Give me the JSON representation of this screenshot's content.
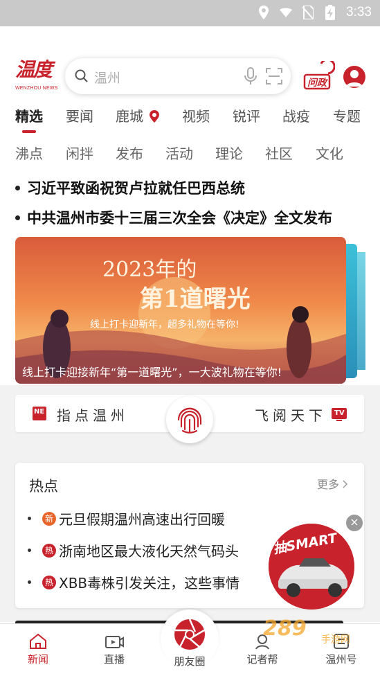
{
  "status_bar": {
    "time": "3:33"
  },
  "header": {
    "logo_main": "温度",
    "logo_sub": "WENZHOU NEWS",
    "search_placeholder": "温州",
    "ask_label": "问政"
  },
  "tabs_row1": [
    "精选",
    "要闻",
    "鹿城",
    "视频",
    "锐评",
    "战疫",
    "专题"
  ],
  "tabs_row2": [
    "沸点",
    "闲拌",
    "发布",
    "活动",
    "理论",
    "社区",
    "文化"
  ],
  "active_tab": "精选",
  "headlines": [
    "习近平致函祝贺卢拉就任巴西总统",
    "中共温州市委十三届三次全会《决定》全文发布"
  ],
  "banner": {
    "art_title_1": "2023年的",
    "art_title_2": "第1道曙光",
    "art_subtitle": "线上打卡迎新年，超多礼物在等你!",
    "caption": "线上打卡迎接新年“第一道曙光”，一大波礼物在等你!"
  },
  "finger_bar": {
    "left_label": "指点温州",
    "right_label": "飞阅天下",
    "left_icon_text": "NE",
    "right_icon_text": "TV"
  },
  "hot": {
    "title": "热点",
    "more": "更多",
    "items": [
      {
        "tag": "新",
        "text": "元旦假期温州高速出行回暖"
      },
      {
        "tag": "热",
        "text": "浙南地区最大液化天然气码头"
      },
      {
        "tag": "热",
        "text": "XBB毒株引发关注，这些事情"
      }
    ]
  },
  "ad": {
    "label": "抽SMART"
  },
  "tab_bar": {
    "items": [
      "新闻",
      "直播",
      "朋友圈",
      "记者帮",
      "温州号"
    ],
    "active": "新闻"
  },
  "watermark": {
    "brand": "289",
    "suffix": "手游网"
  },
  "colors": {
    "brand_red": "#c8232c",
    "status_bar": "#c9c9c9",
    "gray_bg": "#f2f2f2"
  }
}
